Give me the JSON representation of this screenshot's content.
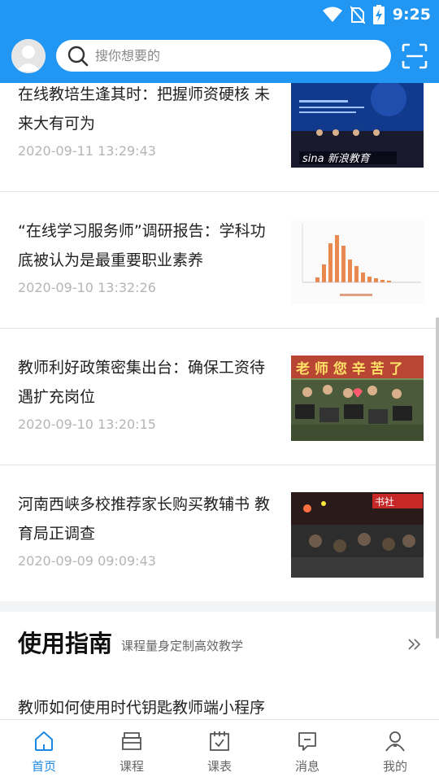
{
  "status_bar": {
    "time": "9:25"
  },
  "search": {
    "placeholder": "搜你想要的"
  },
  "news": [
    {
      "title": "在线教培生逢其时：把握师资硬核 未来大有可为",
      "date": "2020-09-11 13:29:43",
      "thumb": "sina-education-forum-photo"
    },
    {
      "title": "“在线学习服务师”调研报告：学科功底被认为是最重要职业素养",
      "date": "2020-09-10 13:32:26",
      "thumb": "bar-chart-survey-image"
    },
    {
      "title": "教师利好政策密集出台：确保工资待遇扩充岗位",
      "date": "2020-09-10 13:20:15",
      "thumb": "students-holding-signs-photo"
    },
    {
      "title": "河南西峡多校推荐家长购买教辅书 教育局正调查",
      "date": "2020-09-09 09:09:43",
      "thumb": "bookstore-crowd-photo"
    }
  ],
  "guide": {
    "title": "使用指南",
    "subtitle": "课程量身定制高效教学",
    "items": [
      "教师如何使用时代钥匙教师端小程序"
    ]
  },
  "nav": [
    {
      "label": "首页",
      "icon": "home-icon",
      "active": true
    },
    {
      "label": "课程",
      "icon": "course-icon",
      "active": false
    },
    {
      "label": "课表",
      "icon": "schedule-icon",
      "active": false
    },
    {
      "label": "消息",
      "icon": "message-icon",
      "active": false
    },
    {
      "label": "我的",
      "icon": "profile-icon",
      "active": false
    }
  ],
  "colors": {
    "primary": "#2196F3",
    "active_nav": "#1E88E5"
  }
}
